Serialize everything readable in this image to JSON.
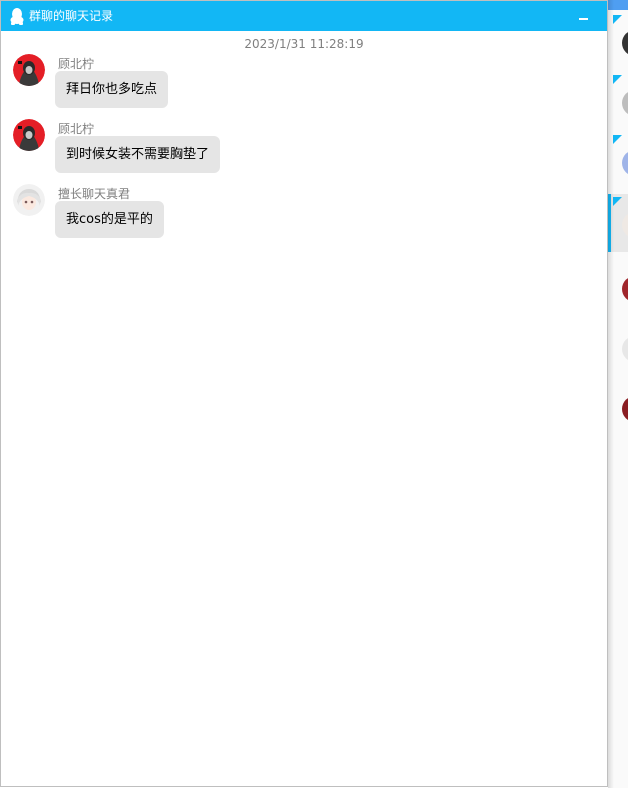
{
  "window": {
    "title": "群聊的聊天记录"
  },
  "colors": {
    "titlebar": "#12b7f5",
    "bubble": "#e5e5e5",
    "sender": "#7f7f7f"
  },
  "timestamp": "2023/1/31 11:28:19",
  "messages": [
    {
      "sender": "顾北柠",
      "text": "拜日你也多吃点",
      "avatar": "red-hooded-avatar"
    },
    {
      "sender": "顾北柠",
      "text": "到时候女装不需要胸垫了",
      "avatar": "red-hooded-avatar"
    },
    {
      "sender": "擅长聊天真君",
      "text": "我cos的是平的",
      "avatar": "white-hair-anime-avatar"
    }
  ],
  "sidebar": {
    "items": [
      {
        "name": "dark-avatar"
      },
      {
        "name": "gray-avatar"
      },
      {
        "name": "blue-anime-avatar"
      },
      {
        "name": "white-hair-avatar",
        "active": true
      },
      {
        "name": "red-avatar"
      },
      {
        "name": "light-avatar"
      },
      {
        "name": "red-dark-avatar"
      }
    ]
  }
}
